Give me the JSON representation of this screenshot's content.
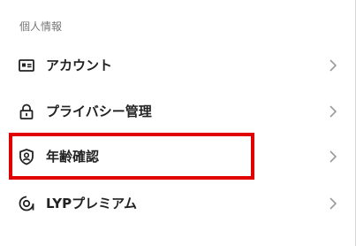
{
  "section": {
    "title": "個人情報"
  },
  "menu": {
    "items": [
      {
        "label": "アカウント",
        "icon": "account-card-icon"
      },
      {
        "label": "プライバシー管理",
        "icon": "lock-icon"
      },
      {
        "label": "年齢確認",
        "icon": "shield-person-icon"
      },
      {
        "label": "LYPプレミアム",
        "icon": "premium-badge-icon"
      }
    ]
  },
  "colors": {
    "highlight": "#e00000",
    "chevron": "#9a9a9a",
    "text": "#222222",
    "section_title": "#777777"
  }
}
